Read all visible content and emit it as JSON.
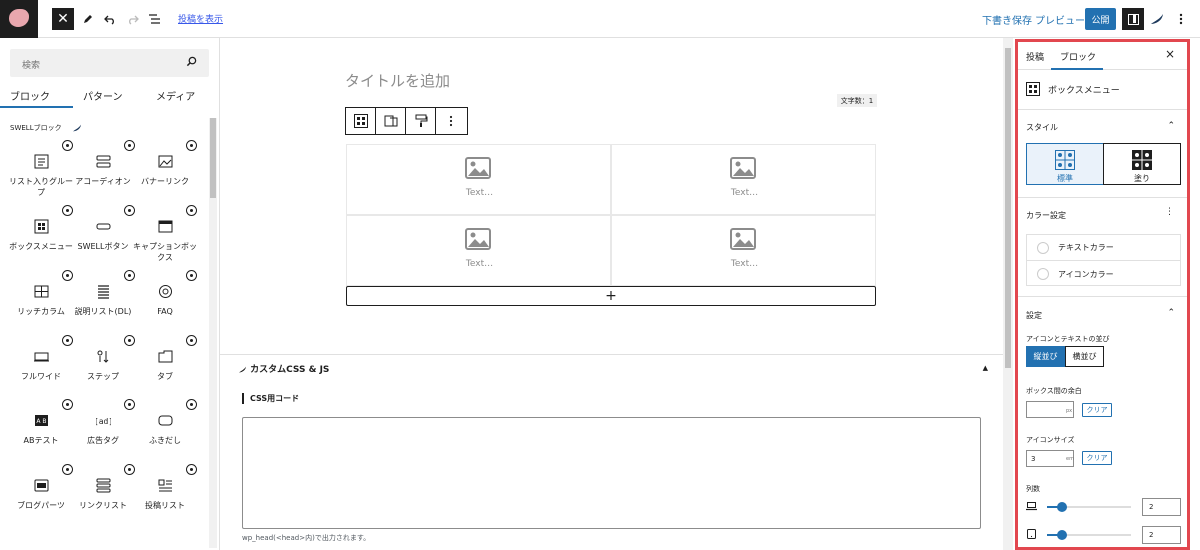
{
  "topbar": {
    "view_post_link": "投稿を表示",
    "save_draft": "下書き保存",
    "preview": "プレビュー",
    "publish": "公開"
  },
  "inserter": {
    "search_placeholder": "検索",
    "tabs": [
      "ブロック",
      "パターン",
      "メディア"
    ],
    "section_label": "SWELLブロック",
    "blocks": [
      {
        "label": "リスト入りグループ"
      },
      {
        "label": "アコーディオン"
      },
      {
        "label": "バナーリンク"
      },
      {
        "label": "ボックスメニュー"
      },
      {
        "label": "SWELLボタン"
      },
      {
        "label": "キャプションボックス"
      },
      {
        "label": "リッチカラム"
      },
      {
        "label": "説明リスト(DL)"
      },
      {
        "label": "FAQ"
      },
      {
        "label": "フルワイド"
      },
      {
        "label": "ステップ"
      },
      {
        "label": "タブ"
      },
      {
        "label": "ABテスト"
      },
      {
        "label": "広告タグ"
      },
      {
        "label": "ふきだし"
      },
      {
        "label": "ブログパーツ"
      },
      {
        "label": "リンクリスト"
      },
      {
        "label": "投稿リスト"
      }
    ]
  },
  "editor": {
    "title_placeholder": "タイトルを追加",
    "word_count": "文字数：1",
    "box_items": [
      "Text…",
      "Text…",
      "Text…",
      "Text…"
    ],
    "add_symbol": "+"
  },
  "meta": {
    "panel_title": "カスタムCSS & JS",
    "css_label": "CSS用コード",
    "note": "wp_head(<head>内)で出力されます。"
  },
  "sidebar": {
    "tabs": [
      "投稿",
      "ブロック"
    ],
    "close": "×",
    "block_name": "ボックスメニュー",
    "style_section": "スタイル",
    "styles": [
      "標準",
      "塗り"
    ],
    "color_section": "カラー設定",
    "colors": [
      "テキストカラー",
      "アイコンカラー"
    ],
    "settings_section": "設定",
    "layout_label": "アイコンとテキストの並び",
    "layout_options": [
      "縦並び",
      "横並び"
    ],
    "padding_label": "ボックス間の余白",
    "padding_value": "",
    "padding_unit": "px",
    "clear": "クリア",
    "icon_size_label": "アイコンサイズ",
    "icon_size_value": "3",
    "icon_size_unit": "em",
    "columns_label": "列数",
    "columns_pc": "2",
    "columns_sp": "2"
  },
  "colors": {
    "accent": "#2271b1",
    "highlight_border": "#e2474f"
  }
}
